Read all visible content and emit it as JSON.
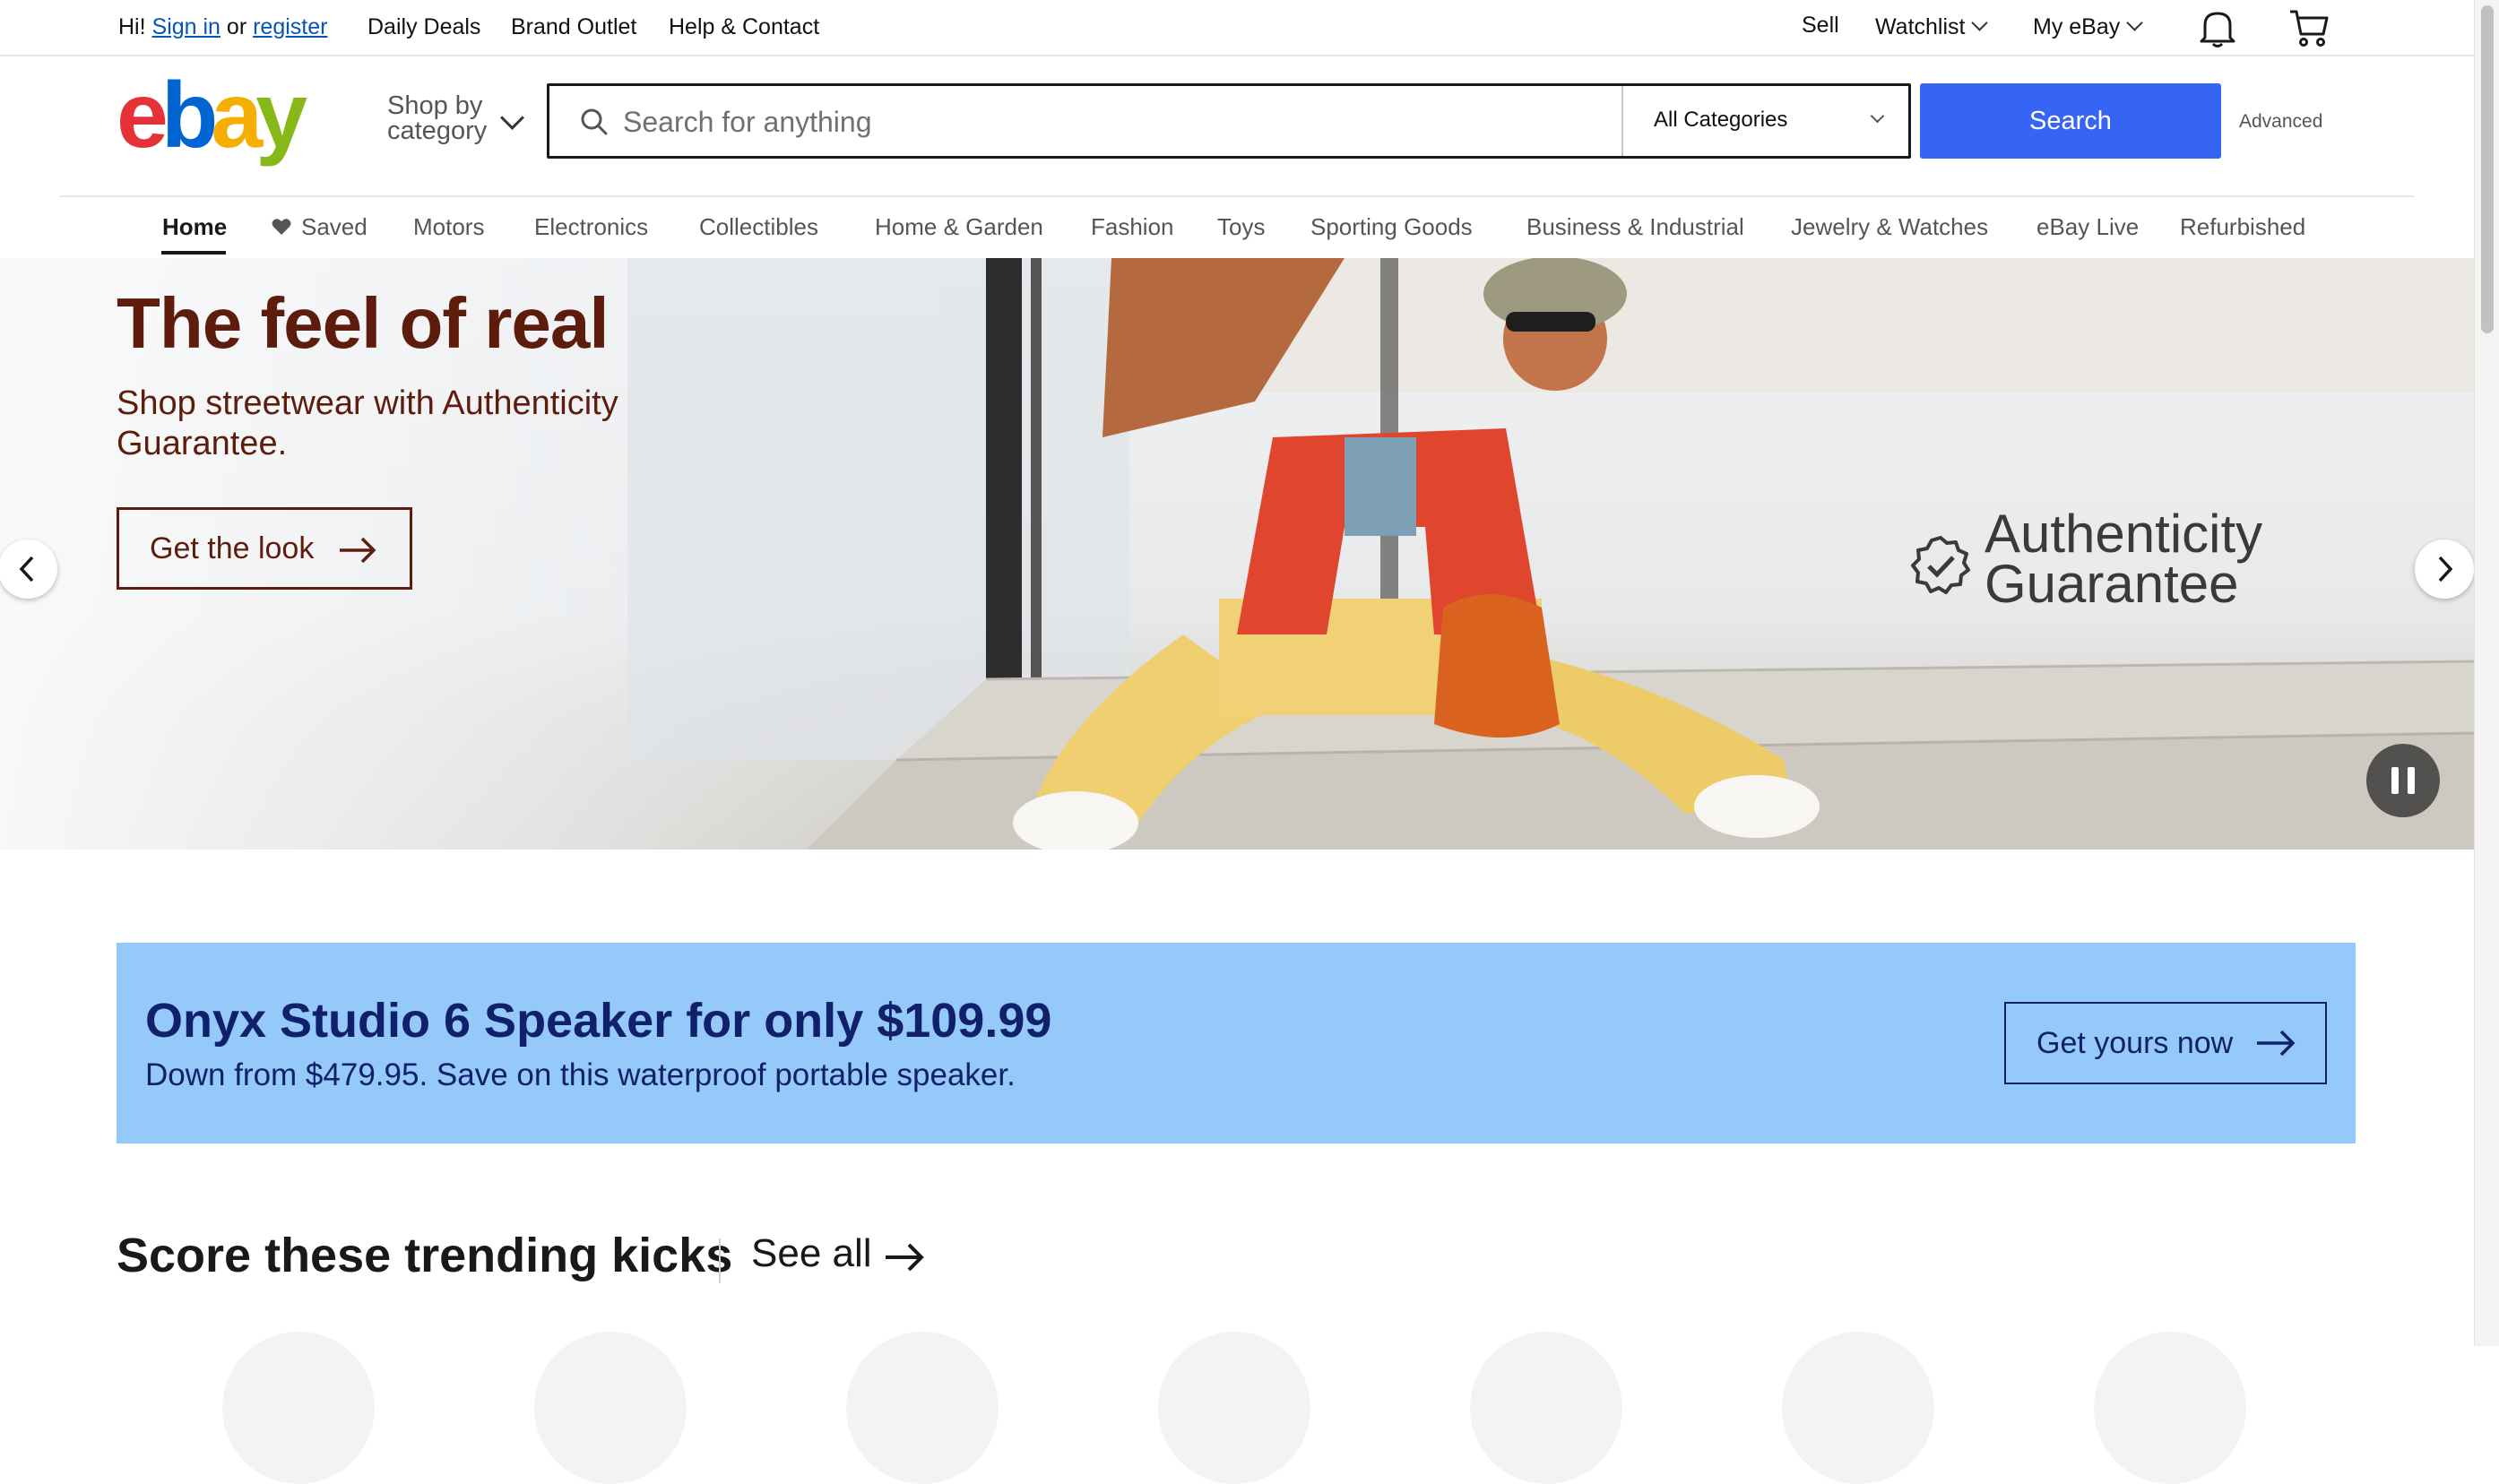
{
  "topbar": {
    "greeting": "Hi!",
    "sign_in": "Sign in",
    "or": "or",
    "register": "register",
    "daily_deals": "Daily Deals",
    "brand_outlet": "Brand Outlet",
    "help_contact": "Help & Contact",
    "sell": "Sell",
    "watchlist": "Watchlist",
    "my_ebay": "My eBay"
  },
  "header": {
    "shop_by_line1": "Shop by",
    "shop_by_line2": "category",
    "search_placeholder": "Search for anything",
    "category_selected": "All Categories",
    "search_button": "Search",
    "advanced": "Advanced"
  },
  "nav": {
    "items": [
      "Home",
      "Saved",
      "Motors",
      "Electronics",
      "Collectibles",
      "Home & Garden",
      "Fashion",
      "Toys",
      "Sporting Goods",
      "Business & Industrial",
      "Jewelry & Watches",
      "eBay Live",
      "Refurbished"
    ],
    "active": "Home"
  },
  "hero": {
    "title": "The feel of real",
    "subtitle": "Shop streetwear with Authenticity Guarantee.",
    "cta": "Get the look",
    "badge_line1": "Authenticity",
    "badge_line2": "Guarantee"
  },
  "promo": {
    "title": "Onyx Studio 6 Speaker for only $109.99",
    "subtitle": "Down from $479.95. Save on this waterproof portable speaker.",
    "cta": "Get yours now"
  },
  "trending": {
    "title": "Score these trending kicks",
    "see_all": "See all"
  },
  "colors": {
    "brand_blue": "#3665f3",
    "hero_text": "#5e1d0c",
    "promo_bg": "#94c9fa",
    "promo_text": "#10206b"
  }
}
